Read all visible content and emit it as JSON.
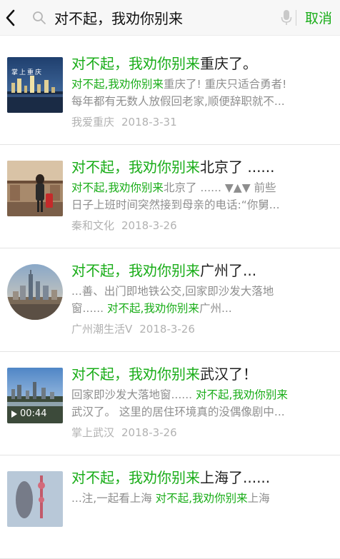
{
  "header": {
    "query": "对不起，我劝你别来",
    "cancel_label": "取消",
    "colors": {
      "accent": "#1aad19"
    }
  },
  "results": [
    {
      "title_hl": "对不起，我劝你别来",
      "title_rest": "重庆了。",
      "snippet_line1_hl": "对不起,我劝你别来",
      "snippet_line1_rest": "重庆了! 重庆只适合勇者!",
      "snippet_line2": "每年都有无数人放假回老家,顺便辞职就不...",
      "source": "我爱重庆",
      "date": "2018-3-31",
      "thumb_text": "掌上重庆"
    },
    {
      "title_hl": "对不起，我劝你别来",
      "title_rest": "北京了 ......",
      "snippet_line1_hl": "对不起,我劝你别来",
      "snippet_line1_rest": "北京了 ...... ▼▲▼ 前些",
      "snippet_line2": "日子上班时间突然接到母亲的电话:“你舅...",
      "source": "秦和文化",
      "date": "2018-3-26"
    },
    {
      "title_hl": "对不起，我劝你别来",
      "title_rest": "广州了...",
      "snippet_line1": "...善、出门即地铁公交,回家即沙发大落地",
      "snippet_line2_pre": "窗...... ",
      "snippet_line2_hl": "对不起,我劝你别来",
      "snippet_line2_rest": "广州...",
      "source": "广州潮生活V",
      "date": "2018-3-26"
    },
    {
      "title_hl": "对不起，我劝你别来",
      "title_rest": "武汉了！",
      "snippet_line1_pre": "回家即沙发大落地窗...... ",
      "snippet_line1_hl": "对不起,我劝你别来",
      "snippet_line2": "武汉了。 这里的居住环境真的没偶像剧中...",
      "source": "掌上武汉",
      "date": "2018-3-26",
      "video_duration": "00:44"
    },
    {
      "title_hl": "对不起，我劝你别来",
      "title_rest": "上海了......",
      "snippet_line1_pre": "...注,一起看上海 ",
      "snippet_line1_hl": "对不起,我劝你别来",
      "snippet_line1_rest": "上海"
    }
  ]
}
